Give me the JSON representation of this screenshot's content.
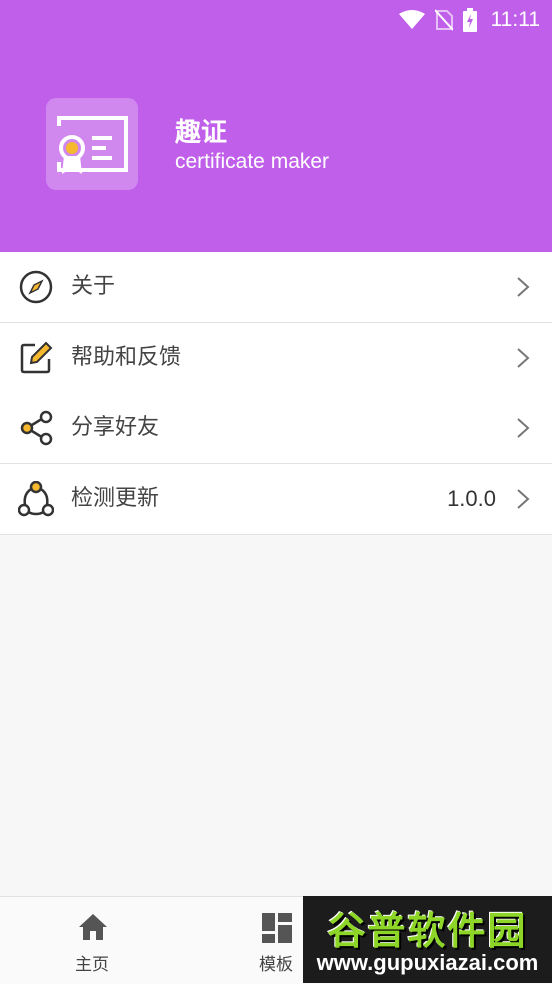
{
  "status_bar": {
    "time": "11:11"
  },
  "app": {
    "name": "趣证",
    "subtitle": "certificate maker"
  },
  "menu": [
    {
      "label": "关于",
      "icon": "compass-icon"
    },
    {
      "label": "帮助和反馈",
      "icon": "edit-icon"
    },
    {
      "label": "分享好友",
      "icon": "share-icon"
    },
    {
      "label": "检测更新",
      "icon": "update-icon",
      "value": "1.0.0"
    }
  ],
  "bottom_nav": [
    {
      "label": "主页",
      "icon": "home-icon"
    },
    {
      "label": "模板",
      "icon": "template-icon"
    }
  ],
  "watermark": {
    "title": "谷普软件园",
    "url": "www.gupuxiazai.com"
  },
  "colors": {
    "accent": "#c05fe9",
    "icon_yellow": "#f5b82e"
  }
}
